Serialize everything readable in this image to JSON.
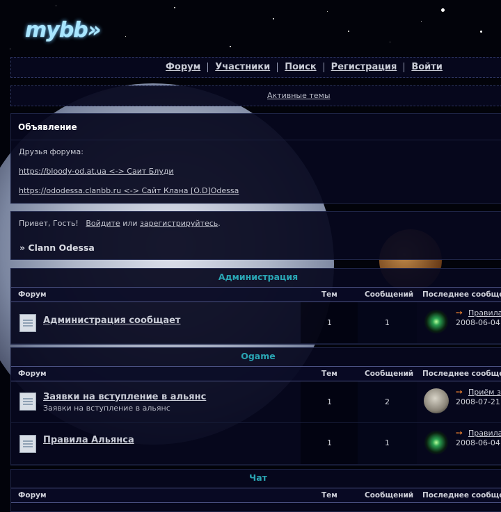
{
  "logo": {
    "text": "mybb»"
  },
  "nav": {
    "items": [
      "Форум",
      "Участники",
      "Поиск",
      "Регистрация",
      "Войти"
    ]
  },
  "subnav": {
    "active_topics": "Активные темы"
  },
  "announcement": {
    "title": "Объявление",
    "friends_label": "Друзья форума:",
    "link1": "https://bloody-od.at.ua <-> Саит Блуди",
    "link2": "https://ododessa.clanbb.ru <-> Сайт Клана [O.D]Odessa"
  },
  "welcome": {
    "greeting": "Привет, Гость!",
    "login": "Войдите",
    "or": "или",
    "register": "зарегистрируйтесь",
    "period": ".",
    "breadcrumb": "» Clann Odessa"
  },
  "columns": {
    "forum": "Форум",
    "topics": "Тем",
    "posts": "Сообщений",
    "last": "Последнее сообщение"
  },
  "categories": [
    {
      "title": "Администрация",
      "forums": [
        {
          "name": "Администрация сообщает",
          "desc": "",
          "topics": "1",
          "posts": "1",
          "last_link": "Правила",
          "last_date": "2008-06-04",
          "avatar": "burst"
        }
      ]
    },
    {
      "title": "Ogame",
      "forums": [
        {
          "name": "Заявки на вступление в альянс",
          "desc": "Заявки на вступление в альянс",
          "topics": "1",
          "posts": "2",
          "last_link": "Приём з",
          "last_date": "2008-07-21",
          "avatar": "moon"
        },
        {
          "name": "Правила Альянса",
          "desc": "",
          "topics": "1",
          "posts": "1",
          "last_link": "Правила",
          "last_date": "2008-06-04",
          "avatar": "burst"
        }
      ]
    },
    {
      "title": "Чат",
      "forums": []
    }
  ],
  "colors": {
    "accent": "#2aa6b4",
    "arrow": "#ff8a30",
    "panel": "#06081e"
  }
}
